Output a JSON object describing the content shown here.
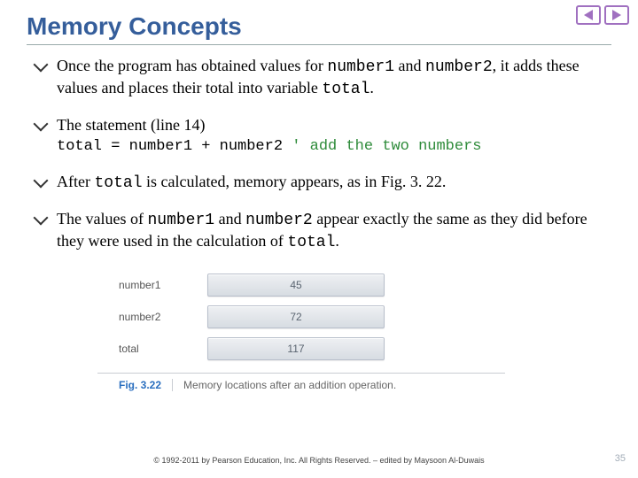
{
  "title": "Memory Concepts",
  "bullets": {
    "b1": {
      "pre": "Once the program has obtained values for ",
      "code1": "number1",
      "mid1": " and ",
      "code2": "number2",
      "mid2": ", it adds these values and places their total into variable ",
      "code3": "total",
      "post": "."
    },
    "b2": {
      "text": "The statement (line 14)",
      "code": "total = number1 + number2 ",
      "comment": "' add the two numbers"
    },
    "b3": {
      "pre": "After ",
      "code1": "total",
      "post": " is calculated, memory appears, as in Fig. 3. 22."
    },
    "b4": {
      "pre": "The values of ",
      "code1": "number1",
      "mid1": " and ",
      "code2": "number2",
      "mid2": " appear exactly the same as they did before they were used in the calculation of ",
      "code3": "total",
      "post": "."
    }
  },
  "figure": {
    "rows": [
      {
        "label": "number1",
        "value": "45"
      },
      {
        "label": "number2",
        "value": "72"
      },
      {
        "label": "total",
        "value": "117"
      }
    ],
    "num": "Fig. 3.22",
    "caption": "Memory locations after an addition operation."
  },
  "copyright": "© 1992-2011 by Pearson Education, Inc. All Rights Reserved. –\nedited by Maysoon Al-Duwais",
  "pagenum": "35"
}
